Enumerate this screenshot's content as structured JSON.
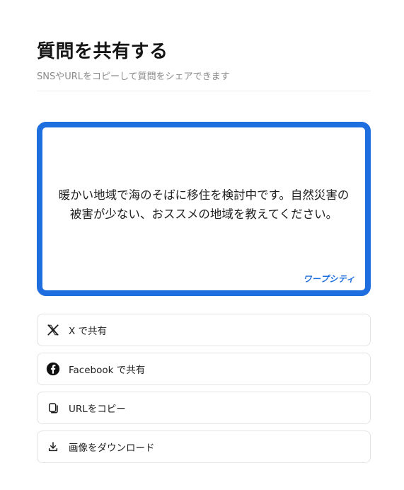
{
  "header": {
    "title": "質問を共有する",
    "subtitle": "SNSやURLをコピーして質問をシェアできます"
  },
  "card": {
    "question": "暖かい地域で海のそばに移住を検討中です。自然災害の被害が少ない、おススメの地域を教えてください。",
    "brand": "ワープシティ",
    "border_color": "#1f6ee0"
  },
  "actions": [
    {
      "label": "X で共有",
      "icon": "x-logo-icon"
    },
    {
      "label": "Facebook で共有",
      "icon": "facebook-icon"
    },
    {
      "label": "URLをコピー",
      "icon": "copy-icon"
    },
    {
      "label": "画像をダウンロード",
      "icon": "download-icon"
    }
  ]
}
